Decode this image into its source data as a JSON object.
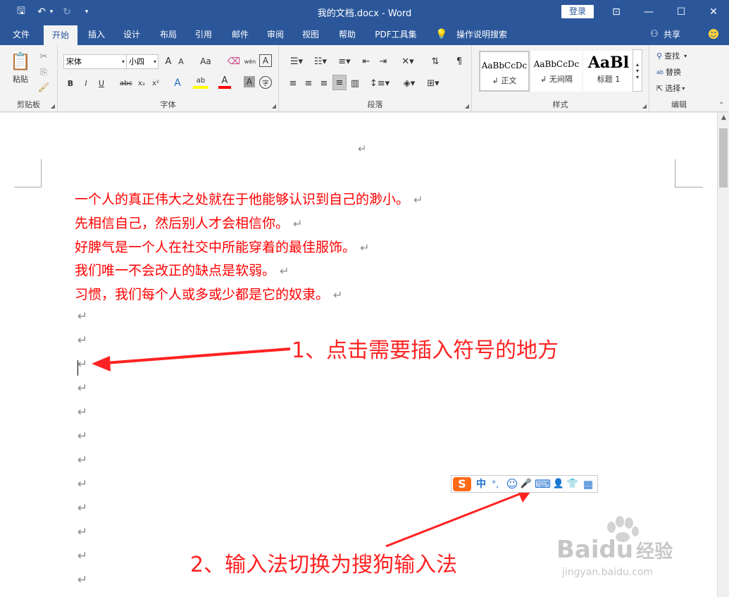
{
  "window": {
    "title": "我的文档.docx  -  Word",
    "login_label": "登录",
    "minimize": "—",
    "maximize": "☐",
    "close": "✕",
    "ribbon_display": "⊡"
  },
  "qat": {
    "save": "🖫",
    "undo": "↶",
    "undo_dd": "▾",
    "redo": "↻",
    "customize": "▾"
  },
  "tabs": [
    {
      "label": "文件"
    },
    {
      "label": "开始"
    },
    {
      "label": "插入"
    },
    {
      "label": "设计"
    },
    {
      "label": "布局"
    },
    {
      "label": "引用"
    },
    {
      "label": "邮件"
    },
    {
      "label": "审阅"
    },
    {
      "label": "视图"
    },
    {
      "label": "帮助"
    },
    {
      "label": "PDF工具集"
    },
    {
      "label": "操作说明搜索"
    }
  ],
  "share_label": "共享",
  "ribbon": {
    "clipboard": {
      "label": "剪贴板",
      "paste": "粘贴"
    },
    "font": {
      "label": "字体",
      "font_name": "宋体",
      "font_size": "小四",
      "grow": "A",
      "shrink": "A",
      "case": "Aa",
      "wen": "wén",
      "char_border": "A",
      "bold": "B",
      "italic": "I",
      "underline": "U",
      "strike": "abc",
      "sub": "x₂",
      "sup": "x²",
      "effects": "A",
      "highlight": "ab",
      "font_color": "A",
      "shading": "A",
      "enclose": "字"
    },
    "paragraph": {
      "label": "段落"
    },
    "styles": {
      "label": "样式",
      "items": [
        {
          "preview": "AaBbCcDc",
          "name": "↲ 正文"
        },
        {
          "preview": "AaBbCcDc",
          "name": "↲ 无间隔"
        },
        {
          "preview": "AaBl",
          "name": "标题 1"
        }
      ]
    },
    "editing": {
      "label": "编辑",
      "find": "查找",
      "replace": "替换",
      "select": "选择"
    }
  },
  "document": {
    "lines": [
      "一个人的真正伟大之处就在于他能够认识到自己的渺小。",
      "先相信自己，然后别人才会相信你。",
      "好脾气是一个人在社交中所能穿着的最佳服饰。",
      "我们唯一不会改正的缺点是软弱。",
      "习惯，我们每个人或多或少都是它的奴隶。"
    ],
    "paragraph_mark": "↵"
  },
  "annotations": {
    "step1": "1、点击需要插入符号的地方",
    "step2": "2、输入法切换为搜狗输入法"
  },
  "sogou": {
    "logo": "S",
    "lang": "中",
    "punct": "°,",
    "emoji": "☺",
    "voice": "🎤",
    "keyboard": "⌨",
    "user": "👤",
    "skin": "👕",
    "tools": "▦"
  },
  "watermark": {
    "brand": "Bai",
    "brand2": "du",
    "jingyan": "经验",
    "url": "jingyan.baidu.com"
  },
  "colors": {
    "title_bar": "#2b579a",
    "doc_text": "#ff0000",
    "annotation": "#ff2222"
  }
}
